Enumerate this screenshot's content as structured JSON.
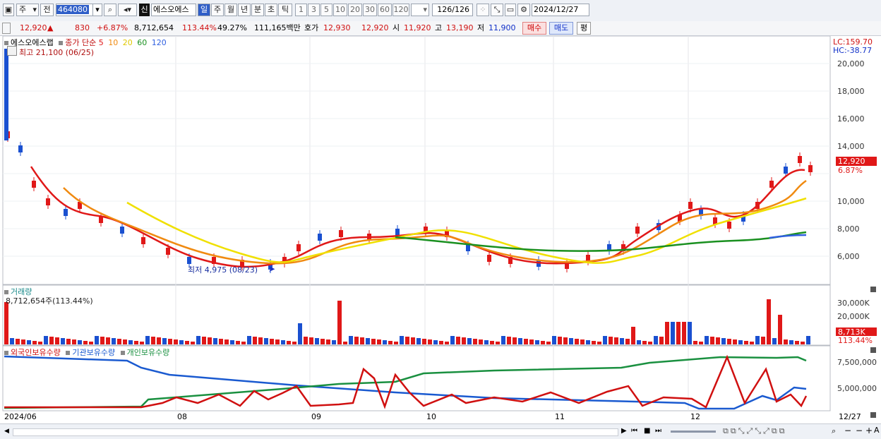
{
  "toolbar": {
    "type_select": "주",
    "prev_label": "전",
    "code": "464080",
    "name_badge": "신",
    "name": "에스오에스",
    "period_tabs": [
      "일",
      "주",
      "월",
      "년",
      "분",
      "초",
      "틱"
    ],
    "active_period": "일",
    "intervals": [
      "1",
      "3",
      "5",
      "10",
      "20",
      "30",
      "60",
      "120"
    ],
    "count": "126",
    "count_total": "/126",
    "date": "2024/12/27"
  },
  "quote": {
    "price": "12,920",
    "change_arrow": "▲",
    "change": "830",
    "change_pct": "+6.87%",
    "volume": "8,712,654",
    "volume_ratio": "113.44%",
    "turnover": "49.27%",
    "amount": "111,165백만",
    "ask_label": "호가",
    "ask": "12,930",
    "bid": "12,920",
    "open_label": "시",
    "open": "11,920",
    "high_label": "고",
    "high": "13,190",
    "low_label": "저",
    "low": "11,900",
    "buy_label": "매수",
    "sell_label": "매도",
    "eval_label": "평"
  },
  "price_panel": {
    "stock_label": "에스오에스랩",
    "ma_label": "종가 단순",
    "ma_periods": [
      "5",
      "10",
      "20",
      "60",
      "120"
    ],
    "ma_colors": [
      "#e01818",
      "#f08a10",
      "#f0e000",
      "#1a9020",
      "#3060e0"
    ],
    "high_note": "최고 21,100 (06/25)",
    "low_note": "최저 4,975 (08/23)",
    "lc": "LC:159.70",
    "hc": "HC:-38.77",
    "current_price_tag": "12,920",
    "current_pct_tag": "6.87%",
    "y_ticks": [
      "20,000",
      "18,000",
      "16,000",
      "14,000",
      "12,000",
      "10,000",
      "8,000",
      "6,000"
    ]
  },
  "volume_panel": {
    "title": "거래량",
    "value_note": "8,712,654주(113.44%)",
    "y_ticks": [
      "30,000K",
      "20,000K"
    ],
    "tag_value": "8,713K",
    "tag_pct": "113.44%"
  },
  "holding_panel": {
    "legend": [
      "외국인보유수량",
      "기관보유수량",
      "개인보유수량"
    ],
    "legend_colors": [
      "#d01010",
      "#1a5ad0",
      "#1a9040"
    ],
    "y_ticks": [
      "7,500,000",
      "5,000,000"
    ]
  },
  "x_axis": {
    "labels": [
      "2024/06",
      "08",
      "09",
      "10",
      "11",
      "12"
    ],
    "end_label": "12/27"
  },
  "colors": {
    "up": "#e01818",
    "down": "#1a50d0",
    "toolbar_bg": "#eef1f6",
    "grid": "#e4e6ea"
  }
}
